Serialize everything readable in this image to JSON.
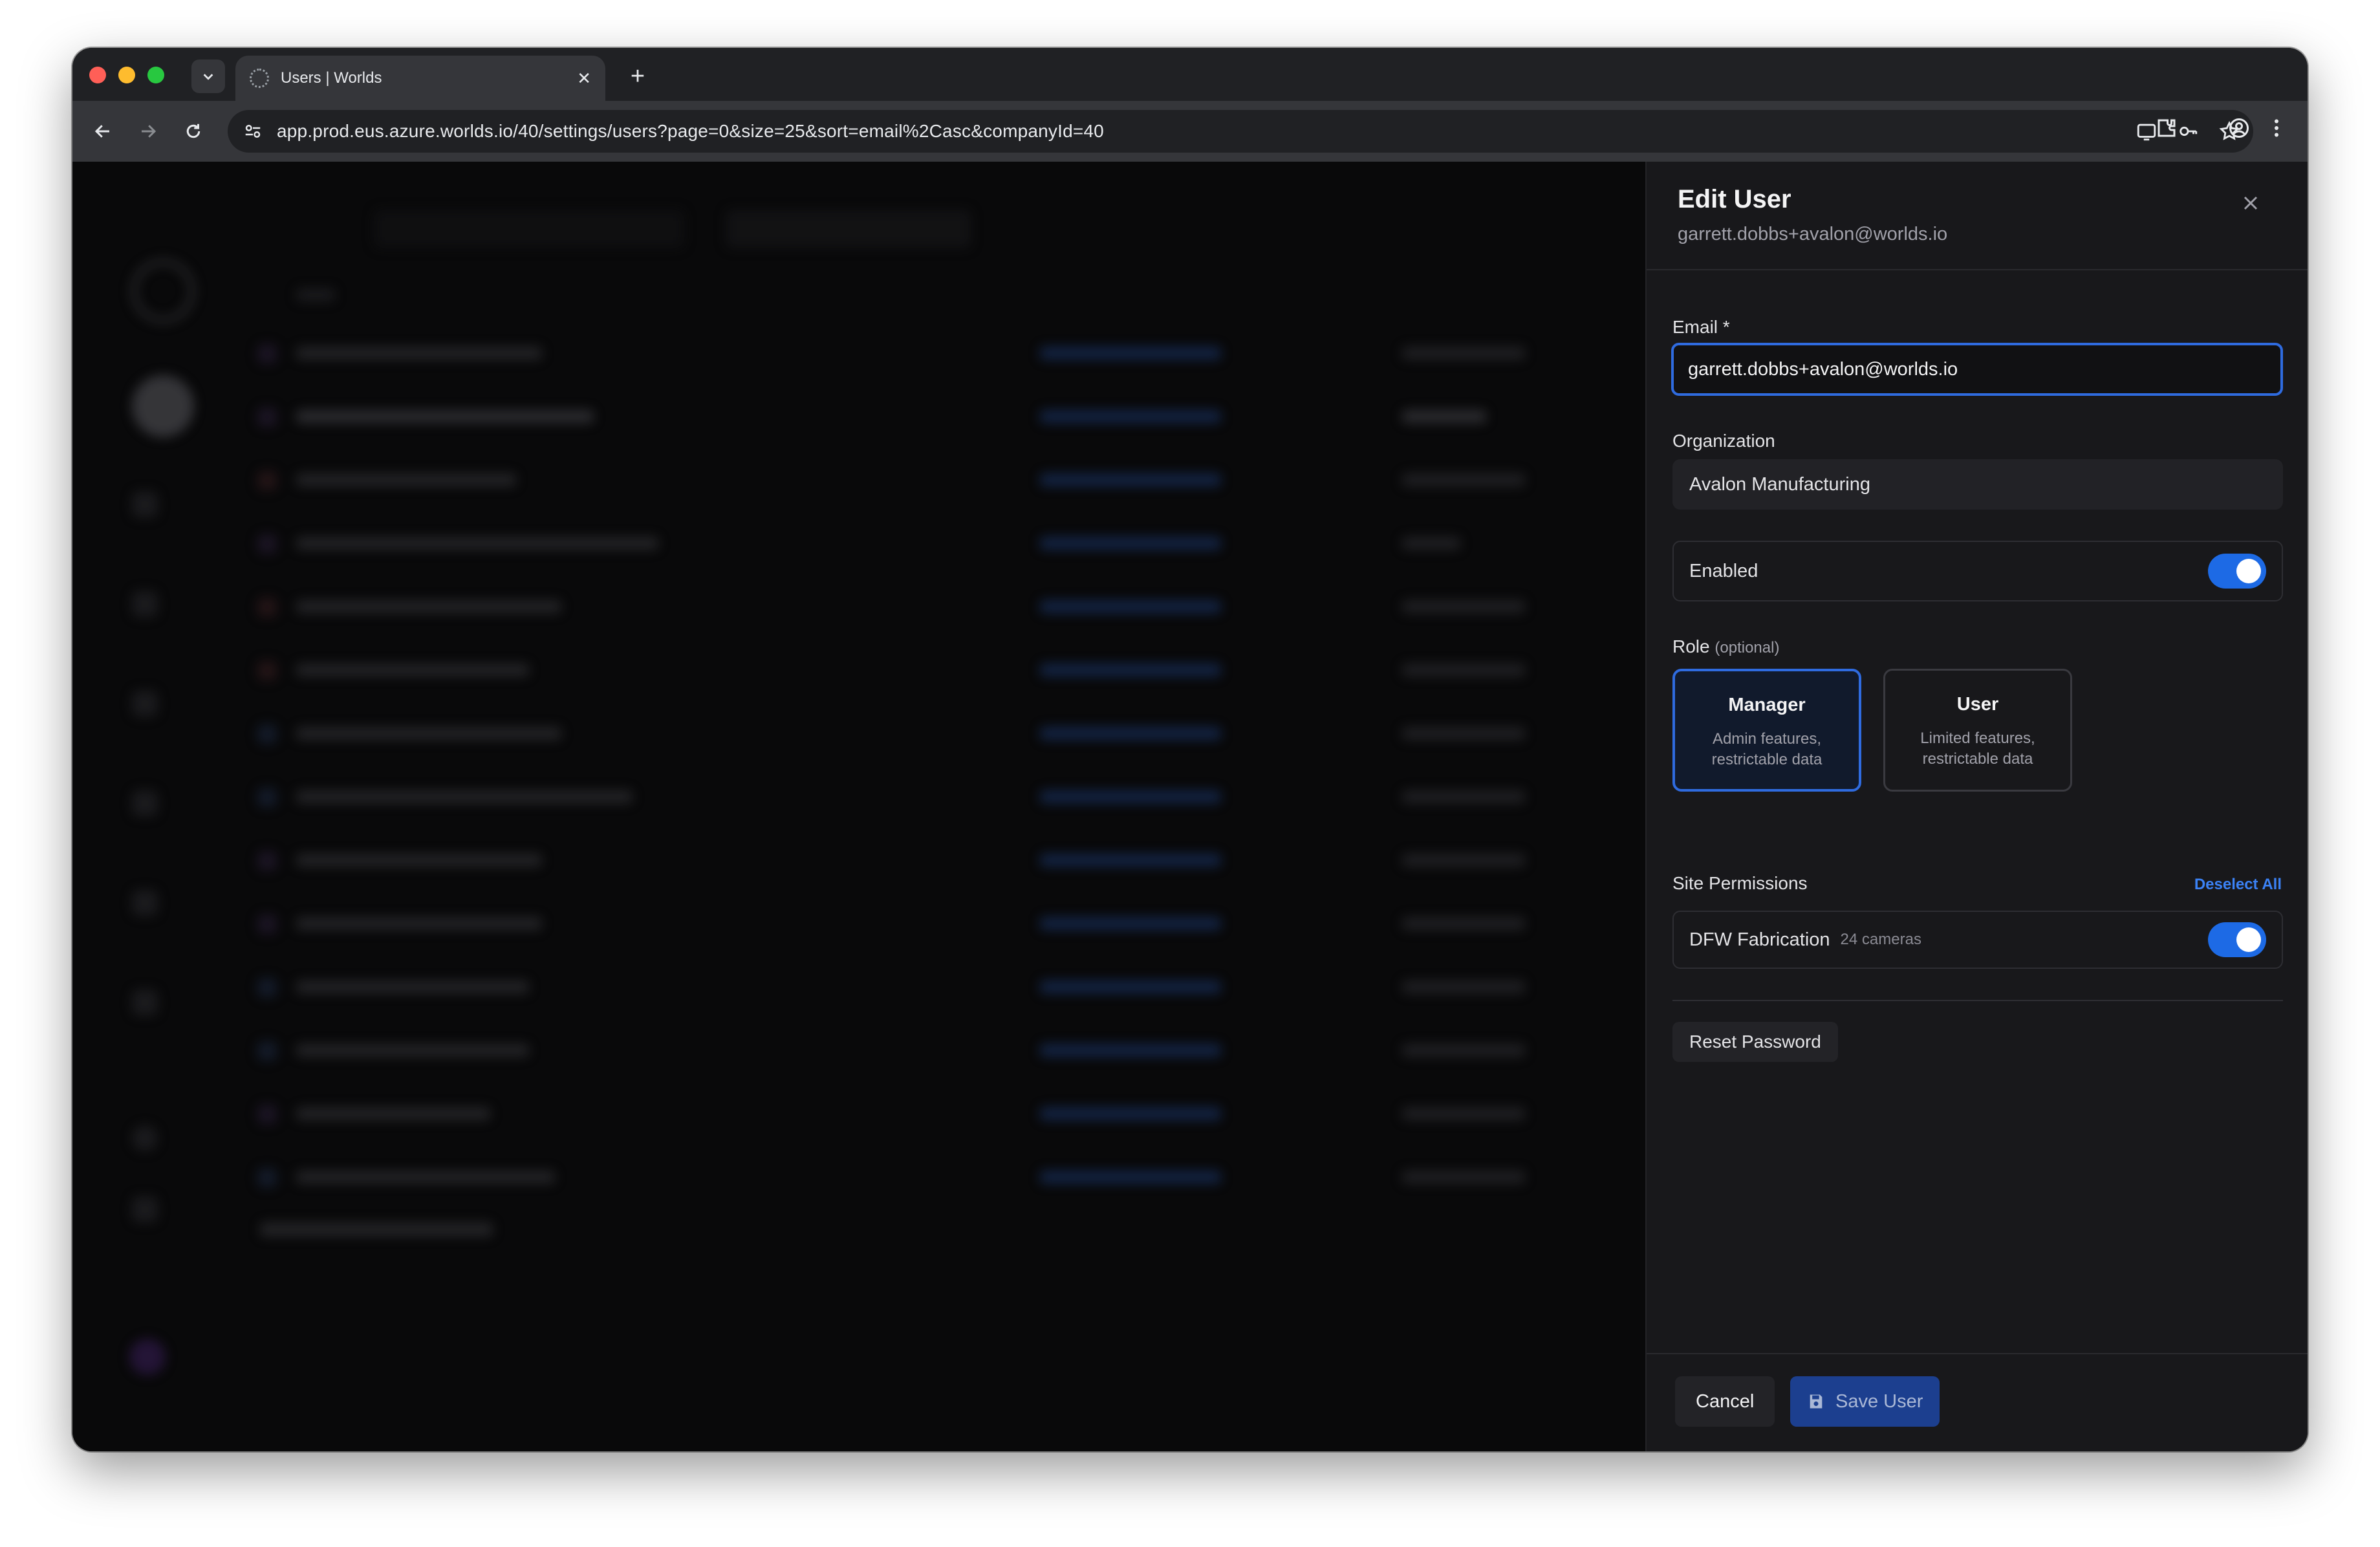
{
  "browser": {
    "tab_title": "Users | Worlds",
    "url": "app.prod.eus.azure.worlds.io/40/settings/users?page=0&size=25&sort=email%2Casc&companyId=40"
  },
  "drawer": {
    "title": "Edit User",
    "subtitle": "garrett.dobbs+avalon@worlds.io",
    "email_label": "Email *",
    "email_value": "garrett.dobbs+avalon@worlds.io",
    "organization_label": "Organization",
    "organization_value": "Avalon Manufacturing",
    "enabled_label": "Enabled",
    "enabled": true,
    "role_label": "Role",
    "role_optional": "(optional)",
    "roles": [
      {
        "name": "Manager",
        "desc_line1": "Admin features,",
        "desc_line2": "restrictable data",
        "selected": true
      },
      {
        "name": "User",
        "desc_line1": "Limited features,",
        "desc_line2": "restrictable data",
        "selected": false
      }
    ],
    "site_permissions_label": "Site Permissions",
    "deselect_all": "Deselect All",
    "sites": [
      {
        "name": "DFW Fabrication",
        "cameras": "24 cameras",
        "enabled": true
      }
    ],
    "reset_password": "Reset Password",
    "cancel": "Cancel",
    "save": "Save User"
  },
  "colors": {
    "accent": "#2f6bdf",
    "toggle_on": "#1d6ae5",
    "link": "#3b82f6",
    "save_button": "#1c3f8f"
  }
}
